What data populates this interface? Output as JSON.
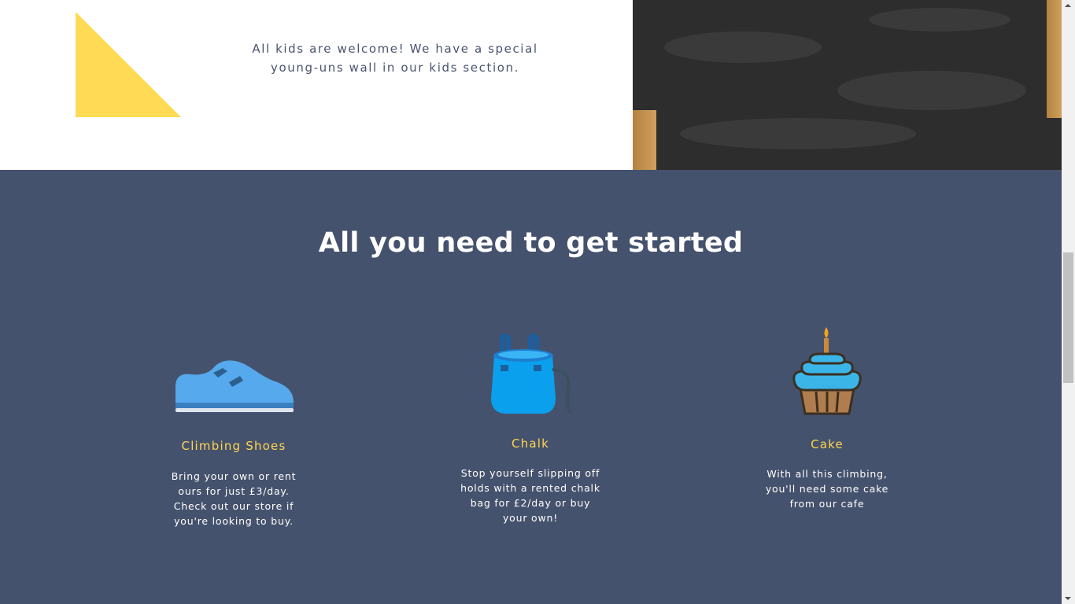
{
  "top": {
    "kids_text": "All kids are welcome! We have a special young-uns wall in our kids section.",
    "accent_color": "#ffdb55"
  },
  "section": {
    "title": "All you need to get started",
    "background_color": "#45526d",
    "accent_color": "#ffd54f"
  },
  "features": [
    {
      "icon": "climbing-shoe-icon",
      "name": "Climbing Shoes",
      "description": "Bring your own or rent ours for just £3/day. Check out our store if you're looking to buy."
    },
    {
      "icon": "chalk-bag-icon",
      "name": "Chalk",
      "description": "Stop yourself slipping off holds with a rented chalk bag for £2/day or buy your own!"
    },
    {
      "icon": "cupcake-icon",
      "name": "Cake",
      "description": "With all this climbing, you'll need some cake from our cafe"
    }
  ]
}
